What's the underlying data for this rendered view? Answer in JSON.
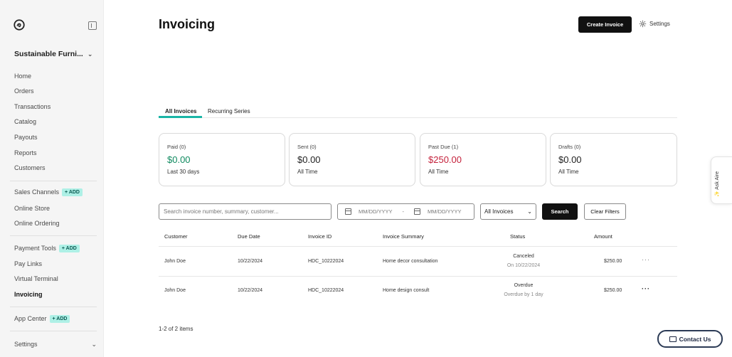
{
  "sidebar": {
    "store_name": "Sustainable Furni...",
    "items": [
      {
        "label": "Home"
      },
      {
        "label": "Orders"
      },
      {
        "label": "Transactions"
      },
      {
        "label": "Catalog"
      },
      {
        "label": "Payouts"
      },
      {
        "label": "Reports"
      },
      {
        "label": "Customers"
      },
      {
        "label": "Sales Channels",
        "badge": "+ ADD"
      },
      {
        "label": "Online Store"
      },
      {
        "label": "Online Ordering"
      },
      {
        "label": "Payment Tools",
        "badge": "+ ADD"
      },
      {
        "label": "Pay Links"
      },
      {
        "label": "Virtual Terminal"
      },
      {
        "label": "Invoicing"
      },
      {
        "label": "App Center",
        "badge": "+ ADD"
      },
      {
        "label": "Settings"
      }
    ]
  },
  "header": {
    "title": "Invoicing",
    "create_label": "Create Invoice",
    "settings_label": "Settings"
  },
  "tabs": [
    {
      "label": "All Invoices"
    },
    {
      "label": "Recurring Series"
    }
  ],
  "cards": [
    {
      "label": "Paid (0)",
      "value": "$0.00",
      "sub": "Last 30 days"
    },
    {
      "label": "Sent (0)",
      "value": "$0.00",
      "sub": "All Time"
    },
    {
      "label": "Past Due (1)",
      "value": "$250.00",
      "sub": "All Time"
    },
    {
      "label": "Drafts (0)",
      "value": "$0.00",
      "sub": "All Time"
    }
  ],
  "filters": {
    "search_placeholder": "Search invoice number, summary, customer...",
    "date_from_placeholder": "MM/DD/YYYY",
    "date_separator": "-",
    "date_to_placeholder": "MM/DD/YYYY",
    "select_value": "All Invoices",
    "search_label": "Search",
    "clear_label": "Clear Filters"
  },
  "table": {
    "headers": [
      "Customer",
      "Due Date",
      "Invoice ID",
      "Invoice Summary",
      "Status",
      "Amount"
    ],
    "rows": [
      {
        "customer": "John Doe",
        "due": "10/22/2024",
        "id": "HDC_10222024",
        "summary": "Home decor consultation",
        "status": "Canceled",
        "status_sub": "On 10/22/2024",
        "amount": "$250.00"
      },
      {
        "customer": "John Doe",
        "due": "10/22/2024",
        "id": "HDC_10222024",
        "summary": "Home design consult",
        "status": "Overdue",
        "status_sub": "Overdue by 1 day",
        "amount": "$250.00"
      }
    ],
    "more_glyph": "···"
  },
  "pager": "1-2 of 2 items",
  "contact_label": "Contact Us",
  "ask_label": "Ask Aire",
  "colors": {
    "accent": "#1ab5a6",
    "paid": "#0f8a5f",
    "past_due": "#c4213b",
    "badge": "#aef0e6"
  }
}
